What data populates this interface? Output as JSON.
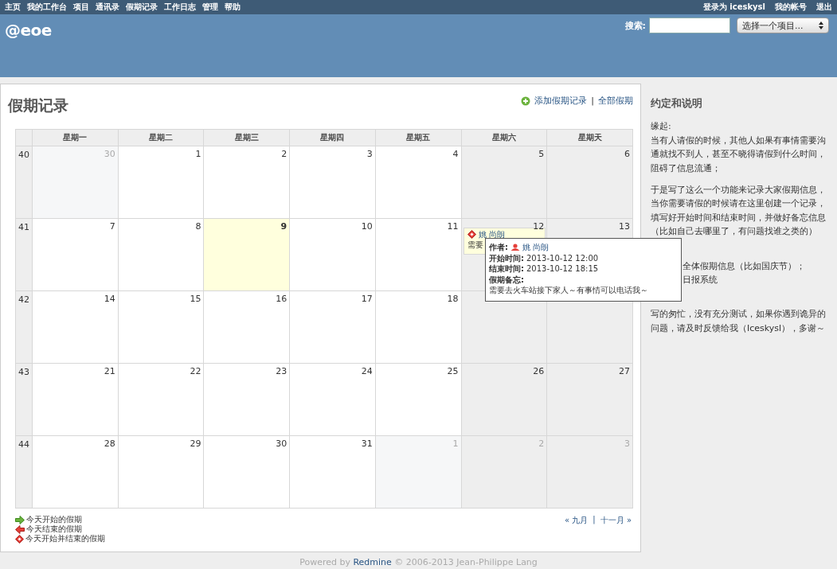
{
  "top_menu": {
    "items": [
      "主页",
      "我的工作台",
      "项目",
      "通讯录",
      "假期记录",
      "工作日志",
      "管理",
      "帮助"
    ],
    "account": [
      "登录为 **iceskysl**",
      "我的帐号",
      "退出"
    ]
  },
  "header": {
    "logo": "@eoe",
    "search_label": "搜索:",
    "project_select": "选择一个项目..."
  },
  "content": {
    "title": "假期记录",
    "actions": [
      "添加假期记录",
      "|",
      "全部假期"
    ],
    "calendar": {
      "weekdays": [
        "星期一",
        "星期二",
        "星期三",
        "星期四",
        "星期五",
        "星期六",
        "星期天"
      ],
      "weeks": [
        {
          "number": "40",
          "days": [
            {
              "day": "30",
              "other_month": true,
              "today": false
            },
            {
              "day": "1",
              "other_month": false,
              "today": false
            },
            {
              "day": "2",
              "other_month": false,
              "today": false
            },
            {
              "day": "3",
              "other_month": false,
              "today": false
            },
            {
              "day": "4",
              "other_month": false,
              "today": false
            },
            {
              "day": "5",
              "other_month": false,
              "today": false
            },
            {
              "day": "6",
              "other_month": false,
              "today": false
            }
          ]
        },
        {
          "number": "41",
          "days": [
            {
              "day": "7",
              "other_month": false,
              "today": false
            },
            {
              "day": "8",
              "other_month": false,
              "today": false
            },
            {
              "day": "9",
              "other_month": false,
              "today": true
            },
            {
              "day": "10",
              "other_month": false,
              "today": false
            },
            {
              "day": "11",
              "other_month": false,
              "today": false
            },
            {
              "day": "12",
              "other_month": false,
              "today": false,
              "events": [
                {
                  "name": "姚 尚朗",
                  "note": "需要"
                }
              ]
            },
            {
              "day": "13",
              "other_month": false,
              "today": false
            }
          ]
        },
        {
          "number": "42",
          "days": [
            {
              "day": "14",
              "other_month": false,
              "today": false
            },
            {
              "day": "15",
              "other_month": false,
              "today": false
            },
            {
              "day": "16",
              "other_month": false,
              "today": false
            },
            {
              "day": "17",
              "other_month": false,
              "today": false
            },
            {
              "day": "18",
              "other_month": false,
              "today": false
            },
            {
              "kind": "covered"
            },
            {
              "kind": "covered"
            }
          ]
        },
        {
          "number": "43",
          "days": [
            {
              "day": "21",
              "other_month": false,
              "today": false
            },
            {
              "day": "22",
              "other_month": false,
              "today": false
            },
            {
              "day": "23",
              "other_month": false,
              "today": false
            },
            {
              "day": "24",
              "other_month": false,
              "today": false
            },
            {
              "day": "25",
              "other_month": false,
              "today": false
            },
            {
              "day": "26",
              "other_month": false,
              "today": false
            },
            {
              "day": "27",
              "other_month": false,
              "today": false
            }
          ]
        },
        {
          "number": "44",
          "days": [
            {
              "day": "28",
              "other_month": false,
              "today": false
            },
            {
              "day": "29",
              "other_month": false,
              "today": false
            },
            {
              "day": "30",
              "other_month": false,
              "today": false
            },
            {
              "day": "31",
              "other_month": false,
              "today": false
            },
            {
              "day": "1",
              "other_month": true,
              "today": false
            },
            {
              "day": "2",
              "other_month": true,
              "today": false
            },
            {
              "day": "3",
              "other_month": true,
              "today": false
            }
          ]
        }
      ]
    },
    "tooltip": {
      "rows": [
        {
          "label": "作者:",
          "value": "姚 尚朗",
          "kind": "author"
        },
        {
          "label": "开始时间:",
          "value": "2013-10-12 12:00",
          "kind": "text"
        },
        {
          "label": "结束时间:",
          "value": "2013-10-12 18:15",
          "kind": "text"
        },
        {
          "label": "假期备忘:",
          "value": "",
          "kind": "text"
        }
      ],
      "note": "需要去火车站接下家人～有事情可以电话我～"
    },
    "legend": [
      {
        "kind": "start",
        "text": "今天开始的假期"
      },
      {
        "kind": "end",
        "text": "今天结束的假期"
      },
      {
        "kind": "both",
        "text": "今天开始并结束的假期"
      }
    ],
    "nav": {
      "prev": "« 九月",
      "separator": "|",
      "next": "十一月 »"
    }
  },
  "sidebar": {
    "title": "约定和说明",
    "paragraphs": [
      {
        "kind": "text",
        "lines": [
          "缘起:",
          "当有人请假的时候，其他人如果有事情需要沟",
          "通就找不到人，甚至不晓得请假到什么时间，",
          "阻碍了信息流通；"
        ]
      },
      {
        "kind": "text",
        "lines": [
          "于是写了这么一个功能来记录大家假期信息，",
          "当你需要请假的时候请在这里创建一个记录，",
          "填写好开始时间和结束时间，并做好备忘信息",
          "（比如自己去哪里了，有问题找谁之类的）"
        ]
      },
      {
        "kind": "covered",
        "lines": [
          "全体假期信息（比如国庆节）；",
          "日报系统"
        ]
      },
      {
        "kind": "text",
        "lines": [
          "写的匆忙，没有充分测试，如果你遇到诡异的",
          "问题，请及时反馈给我（Iceskysl），多谢～"
        ]
      }
    ]
  },
  "footer": {
    "prefix": "Powered by",
    "link": "Redmine",
    "suffix": "© 2006-2013 Jean-Philippe Lang"
  }
}
